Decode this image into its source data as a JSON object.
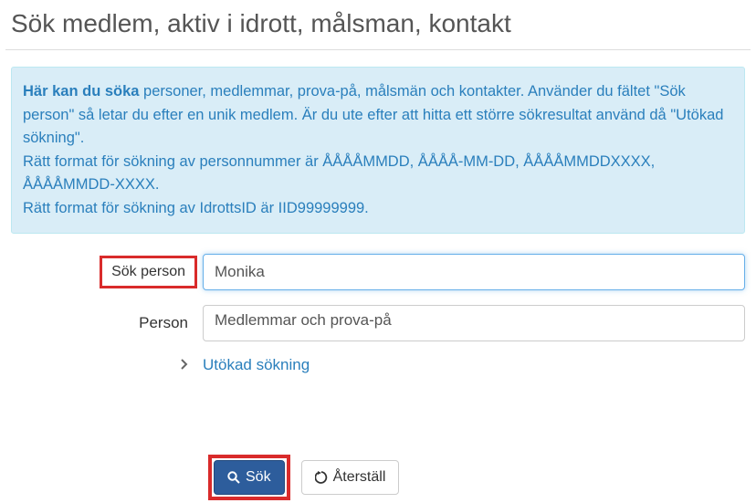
{
  "page_title": "Sök medlem, aktiv i idrott, målsman, kontakt",
  "info": {
    "strong": "Här kan du söka",
    "line1_rest": " personer, medlemmar, prova-på, målsmän och kontakter. Använder du fältet \"Sök person\" så letar du efter en unik medlem. Är du ute efter att hitta ett större sökresultat använd då \"Utökad sökning\".",
    "line2": "Rätt format för sökning av personnummer är ÅÅÅÅMMDD, ÅÅÅÅ-MM-DD, ÅÅÅÅMMDDXXXX, ÅÅÅÅMMDD-XXXX.",
    "line3": "Rätt format för sökning av IdrottsID är IID99999999."
  },
  "labels": {
    "search_person": "Sök person",
    "person": "Person",
    "advanced_search": "Utökad sökning"
  },
  "inputs": {
    "search_value": "Monika",
    "person_select_value": "Medlemmar och prova-på"
  },
  "buttons": {
    "search": "Sök",
    "reset": "Återställ"
  }
}
